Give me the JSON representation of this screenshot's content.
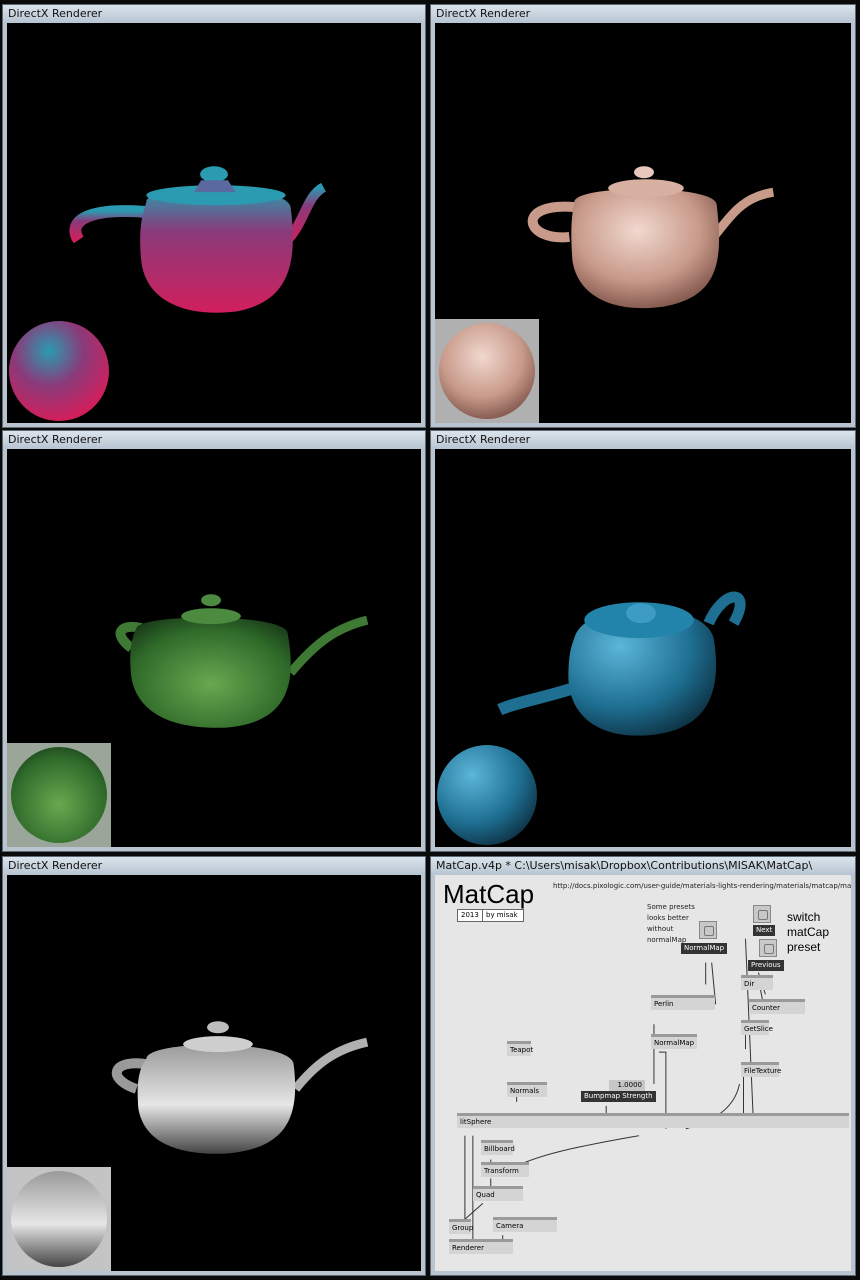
{
  "windows": [
    {
      "title": "DirectX Renderer",
      "material": "red-cyan"
    },
    {
      "title": "DirectX Renderer",
      "material": "pink-ceramic"
    },
    {
      "title": "DirectX Renderer",
      "material": "green-glass"
    },
    {
      "title": "DirectX Renderer",
      "material": "blue-gloss"
    },
    {
      "title": "DirectX Renderer",
      "material": "chrome"
    }
  ],
  "colors": {
    "red_cyan": [
      "#d21f5c",
      "#2a9bb0"
    ],
    "pink": [
      "#c89a8a",
      "#e8c8bc"
    ],
    "green": [
      "#2f6a2a",
      "#6aa84f"
    ],
    "blue": [
      "#1e6f92",
      "#5bb6d9"
    ],
    "chrome": [
      "#6b6b6b",
      "#e6e6e6"
    ]
  },
  "patch": {
    "window_title": "MatCap.v4p *  C:\\Users\\misak\\Dropbox\\Contributions\\MISAK\\MatCap\\",
    "title": "MatCap",
    "url": "http://docs.pixologic.com/user-guide/materials-lights-rendering/materials/matcap/matcap-",
    "year": "2013",
    "author": "by misak",
    "note_presets": [
      "Some presets",
      "looks better",
      "without",
      "normalMap"
    ],
    "note_switch": [
      "switch",
      "matCap",
      "preset"
    ],
    "nodes": {
      "normalmap_toggle": "NormalMap",
      "next": "Next",
      "previous": "Previous",
      "dir": "Dir",
      "counter": "Counter",
      "getslice": "GetSlice",
      "filetexture": "FileTexture",
      "perlin": "Perlin",
      "normalmap": "NormalMap",
      "teapot": "Teapot",
      "normals": "Normals",
      "bumpmap_value": "1.0000",
      "bumpmap": "Bumpmap Strength",
      "litsphere": "litSphere",
      "billboard": "Billboard",
      "transform": "Transform",
      "quad": "Quad",
      "group": "Group",
      "camera": "Camera",
      "renderer": "Renderer"
    }
  }
}
